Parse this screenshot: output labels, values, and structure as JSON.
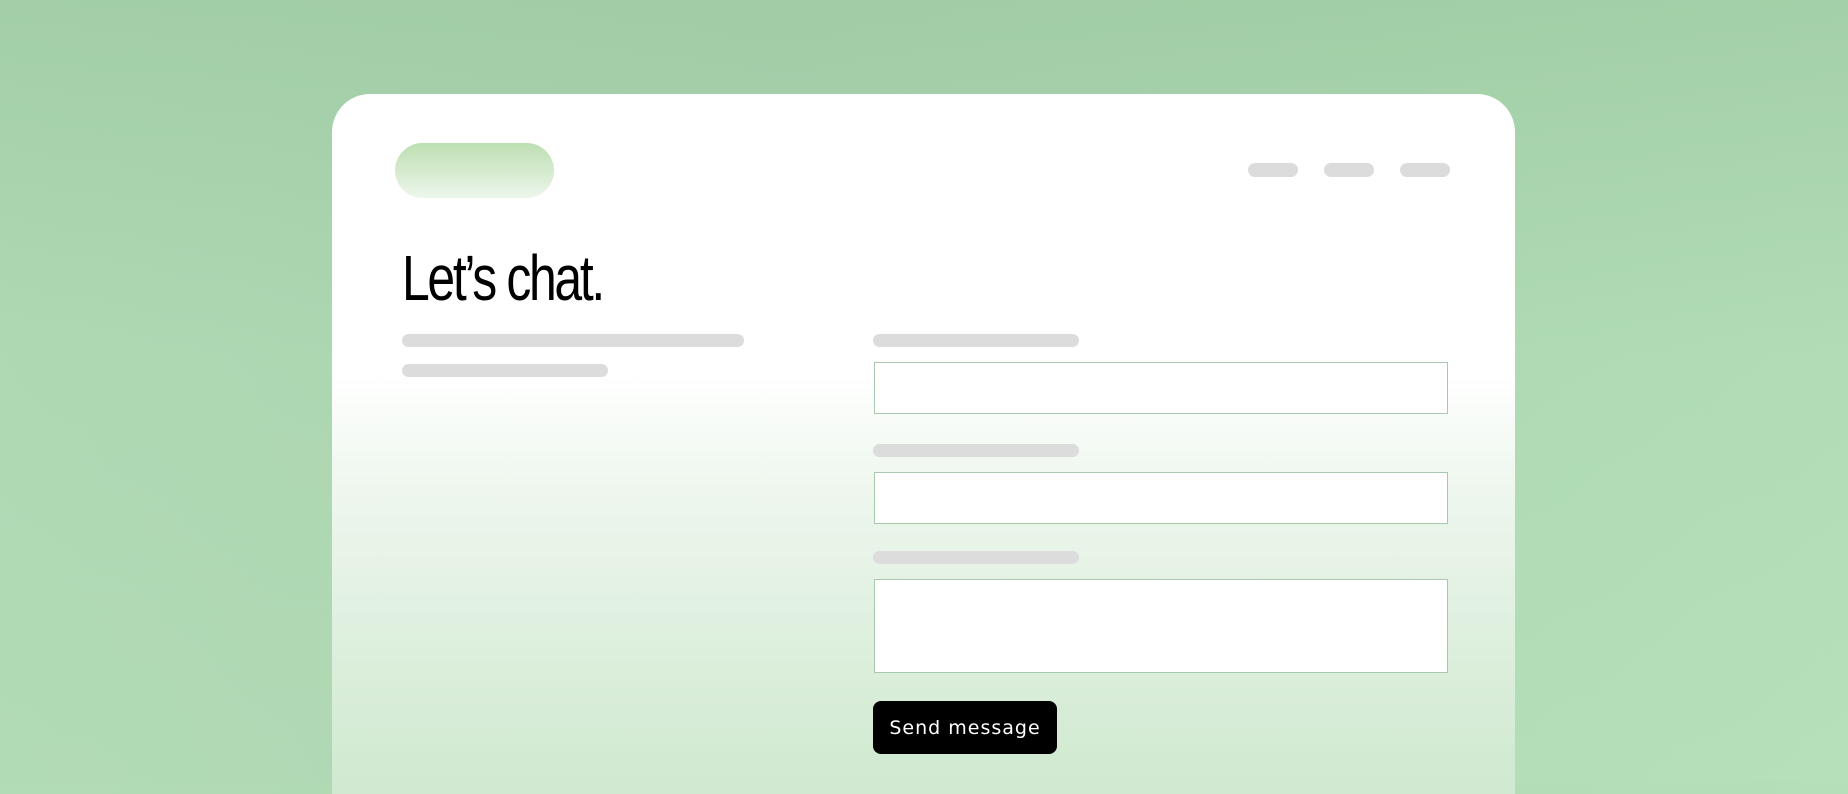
{
  "header": {
    "logo": "logo-placeholder",
    "nav_items": [
      "nav-placeholder-1",
      "nav-placeholder-2",
      "nav-placeholder-3"
    ]
  },
  "main": {
    "title": "Let’s chat."
  },
  "form": {
    "fields": [
      {
        "type": "text",
        "value": "",
        "placeholder": ""
      },
      {
        "type": "text",
        "value": "",
        "placeholder": ""
      },
      {
        "type": "textarea",
        "value": "",
        "placeholder": ""
      }
    ],
    "submit_label": "Send message"
  },
  "colors": {
    "background": "#b1dbb5",
    "card": "#ffffff",
    "placeholder_bar": "#dcdcdc",
    "input_border": "#a9c8ad",
    "button_bg": "#000000",
    "button_text": "#ffffff",
    "logo_accent": "#bddfb3"
  }
}
